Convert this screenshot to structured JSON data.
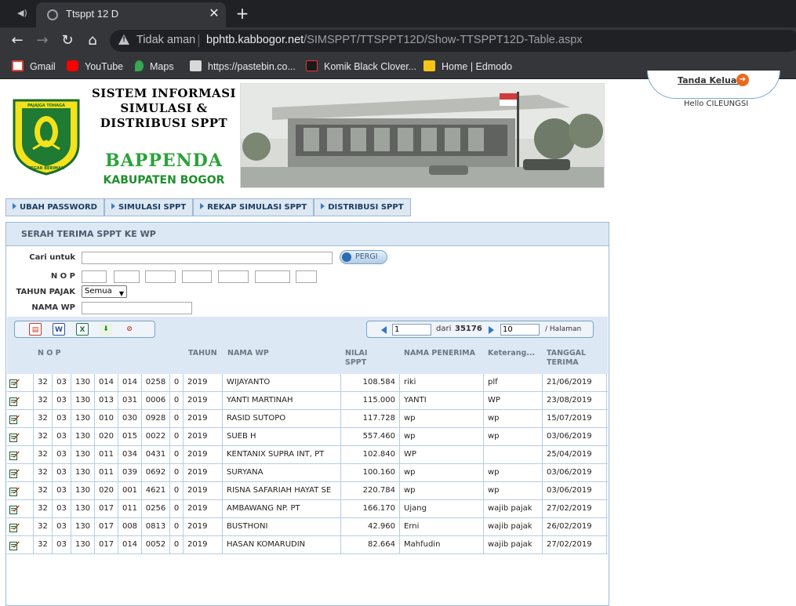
{
  "browser": {
    "tab_title": "Ttsppt 12 D",
    "security_label": "Tidak aman",
    "url_host": "bphtb.kabbogor.net",
    "url_path": "/SIMSPPT/TTSPPT12D/Show-TTSPPT12D-Table.aspx",
    "bookmarks": [
      {
        "label": "Gmail",
        "icon": "gmail-icon",
        "color": "#ea4335"
      },
      {
        "label": "YouTube",
        "icon": "youtube-icon",
        "color": "#ff0000"
      },
      {
        "label": "Maps",
        "icon": "maps-icon",
        "color": "#34a853"
      },
      {
        "label": "https://pastebin.co...",
        "icon": "pastebin-icon",
        "color": "#d9d9d9"
      },
      {
        "label": "Komik Black Clover...",
        "icon": "komik-icon",
        "color": "#e53935"
      },
      {
        "label": "Home | Edmodo",
        "icon": "edmodo-icon",
        "color": "#f5c518"
      }
    ]
  },
  "header": {
    "brand_line1": "SISTEM INFORMASI",
    "brand_line2": "SIMULASI  &",
    "brand_line3": "DISTRIBUSI SPPT",
    "brand_name": "BAPPENDA",
    "brand_region": "KABUPATEN BOGOR",
    "logo_motto": "PAJAJGA TOHAGA SAGALA TEGAR BERIMAN",
    "logout_label": "Tanda Keluar",
    "greeting": "Hello CILEUNGSI"
  },
  "menu": [
    {
      "label": "UBAH PASSWORD"
    },
    {
      "label": "SIMULASI SPPT"
    },
    {
      "label": "REKAP SIMULASI SPPT"
    },
    {
      "label": "DISTRIBUSI SPPT"
    }
  ],
  "panel": {
    "title": "SERAH TERIMA SPPT KE WP",
    "search_label": "Cari untuk",
    "search_value": "",
    "go_label": "PERGI",
    "nop_label": "N O P",
    "tahun_label": "TAHUN PAJAK",
    "tahun_value": "Semua",
    "nama_label": "NAMA WP",
    "nama_value": ""
  },
  "pager": {
    "page": "1",
    "of_label": "dari",
    "total_pages": "35176",
    "page_size": "10",
    "per_page_label": "/ Halaman"
  },
  "columns": {
    "nop": "N O P",
    "tahun": "TAHUN",
    "nama_wp": "NAMA WP",
    "nilai": "NILAI",
    "nilai2": "SPPT",
    "penerima": "NAMA PENERIMA",
    "keterangan": "Keterang...",
    "tanggal": "TANGGAL",
    "tanggal2": "TERIMA"
  },
  "rows": [
    {
      "n1": "32",
      "n2": "03",
      "n3": "130",
      "n4": "014",
      "n5": "014",
      "n6": "0258",
      "n7": "0",
      "tahun": "2019",
      "nama": "WIJAYANTO",
      "nilai": "108.584",
      "penerima": "riki",
      "ket": "plf",
      "tgl": "21/06/2019"
    },
    {
      "n1": "32",
      "n2": "03",
      "n3": "130",
      "n4": "013",
      "n5": "031",
      "n6": "0006",
      "n7": "0",
      "tahun": "2019",
      "nama": "YANTI MARTINAH",
      "nilai": "115.000",
      "penerima": "YANTI",
      "ket": "WP",
      "tgl": "23/08/2019"
    },
    {
      "n1": "32",
      "n2": "03",
      "n3": "130",
      "n4": "010",
      "n5": "030",
      "n6": "0928",
      "n7": "0",
      "tahun": "2019",
      "nama": "RASID SUTOPO",
      "nilai": "117.728",
      "penerima": "wp",
      "ket": "wp",
      "tgl": "15/07/2019"
    },
    {
      "n1": "32",
      "n2": "03",
      "n3": "130",
      "n4": "020",
      "n5": "015",
      "n6": "0022",
      "n7": "0",
      "tahun": "2019",
      "nama": "SUEB H",
      "nilai": "557.460",
      "penerima": "wp",
      "ket": "wp",
      "tgl": "03/06/2019"
    },
    {
      "n1": "32",
      "n2": "03",
      "n3": "130",
      "n4": "011",
      "n5": "034",
      "n6": "0431",
      "n7": "0",
      "tahun": "2019",
      "nama": "KENTANIX SUPRA INT, PT",
      "nilai": "102.840",
      "penerima": "WP",
      "ket": "",
      "tgl": "25/04/2019"
    },
    {
      "n1": "32",
      "n2": "03",
      "n3": "130",
      "n4": "011",
      "n5": "039",
      "n6": "0692",
      "n7": "0",
      "tahun": "2019",
      "nama": "SURYANA",
      "nilai": "100.160",
      "penerima": "wp",
      "ket": "wp",
      "tgl": "03/06/2019"
    },
    {
      "n1": "32",
      "n2": "03",
      "n3": "130",
      "n4": "020",
      "n5": "001",
      "n6": "4621",
      "n7": "0",
      "tahun": "2019",
      "nama": "RISNA SAFARIAH HAYAT SE",
      "nilai": "220.784",
      "penerima": "wp",
      "ket": "wp",
      "tgl": "03/06/2019"
    },
    {
      "n1": "32",
      "n2": "03",
      "n3": "130",
      "n4": "017",
      "n5": "011",
      "n6": "0256",
      "n7": "0",
      "tahun": "2019",
      "nama": "AMBAWANG NP. PT",
      "nilai": "166.170",
      "penerima": "Ujang",
      "ket": "wajib pajak",
      "tgl": "27/02/2019"
    },
    {
      "n1": "32",
      "n2": "03",
      "n3": "130",
      "n4": "017",
      "n5": "008",
      "n6": "0813",
      "n7": "0",
      "tahun": "2019",
      "nama": "BUSTHONI",
      "nilai": "42.960",
      "penerima": "Erni",
      "ket": "wajib pajak",
      "tgl": "26/02/2019"
    },
    {
      "n1": "32",
      "n2": "03",
      "n3": "130",
      "n4": "017",
      "n5": "014",
      "n6": "0052",
      "n7": "0",
      "tahun": "2019",
      "nama": "HASAN KOMARUDIN",
      "nilai": "82.664",
      "penerima": "Mahfudin",
      "ket": "wajib pajak",
      "tgl": "27/02/2019"
    }
  ]
}
